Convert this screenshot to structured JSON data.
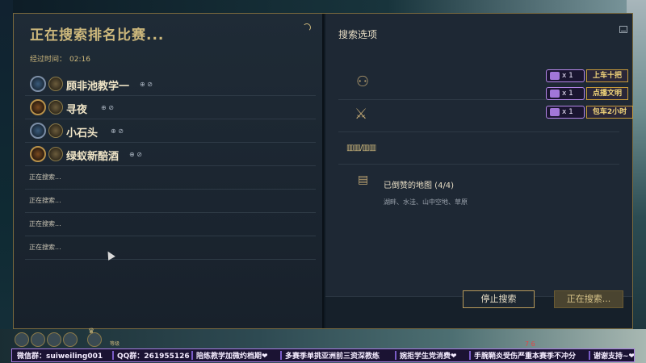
{
  "search": {
    "title": "正在搜索排名比赛...",
    "elapsed_label": "经过时间：",
    "elapsed_value": "02:16"
  },
  "players": [
    {
      "name": "顾非池教学一",
      "rank": "silver"
    },
    {
      "name": "寻夜",
      "rank": "gold"
    },
    {
      "name": "小石头",
      "rank": "silver"
    },
    {
      "name": "绿蚁新醅酒",
      "rank": "gold"
    }
  ],
  "searching_slots": [
    "正在搜索...",
    "正在搜索...",
    "正在搜索...",
    "正在搜索..."
  ],
  "options": {
    "title": "搜索选项",
    "role_icons": "▥▥/▥▥",
    "maps_title": "已倒赞的地图 (4/4)",
    "maps_list": "湖畔、水洼、山中空地、草原"
  },
  "buttons": {
    "stop": "停止搜索",
    "searching": "正在搜索..."
  },
  "overlay_badges": [
    {
      "count": "x 1",
      "label": "上车十把"
    },
    {
      "count": "x 1",
      "label": "点播文明"
    },
    {
      "count": "x 1",
      "label": "包车2小时"
    }
  ],
  "bottom_strip": {
    "mini_text": "等级",
    "red_numbers": "7   6"
  },
  "ticker": [
    "微信群：suiweiling001",
    "QQ群：261955126",
    "陪练教学加微约档期❤",
    "多赛季单挑亚洲前三资深教练",
    "婉拒学生党消费❤",
    "手腕鞘炎受伤严重本赛季不冲分",
    "谢谢支持~❤"
  ],
  "colors": {
    "gold_accent": "#cdb87c",
    "panel_bg": "#1e2834",
    "badge_border": "#b486e8"
  }
}
